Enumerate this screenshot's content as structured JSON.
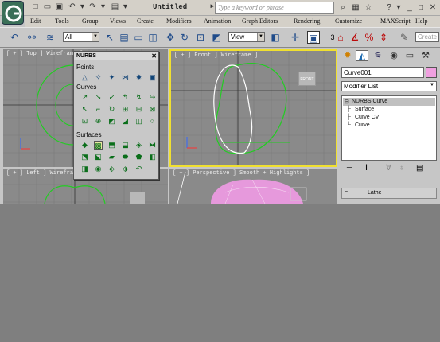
{
  "window": {
    "title": "Untitled",
    "search_placeholder": "Type a keyword or phrase"
  },
  "menus": [
    "Edit",
    "Tools",
    "Group",
    "Views",
    "Create",
    "Modifiers",
    "Animation",
    "Graph Editors",
    "Rendering",
    "Customize",
    "MAXScript",
    "Help"
  ],
  "toolbar": {
    "selection_filter": "All",
    "ref_coord": "View",
    "snap_label": "3",
    "named_sel_placeholder": "Create"
  },
  "viewports": {
    "top": "[ + ] Top ] Wireframe ]",
    "front": "[ + ] Front ] Wireframe ]",
    "left": "[ + ] Left ] Wireframe ]",
    "perspective": "[ + ] Perspective ] Smooth + Highlights ]",
    "front_viewcube": "FRONT"
  },
  "nurbs_panel": {
    "title": "NURBS",
    "groups": [
      "Points",
      "Curves",
      "Surfaces"
    ]
  },
  "command_panel": {
    "object_name": "Curve001",
    "object_color": "#f0a0e0",
    "modifier_list": "Modifier List",
    "stack": [
      {
        "label": "NURBS Curve",
        "level": 0,
        "selected": true
      },
      {
        "label": "Surface",
        "level": 1
      },
      {
        "label": "Curve CV",
        "level": 1
      },
      {
        "label": "Curve",
        "level": 1
      }
    ],
    "rollout": "Lathe"
  },
  "colors": {
    "accent_active_viewport": "#f0e030",
    "nurbs_green": "#0a6e1a",
    "stack_selected": "#c0c0c0"
  }
}
